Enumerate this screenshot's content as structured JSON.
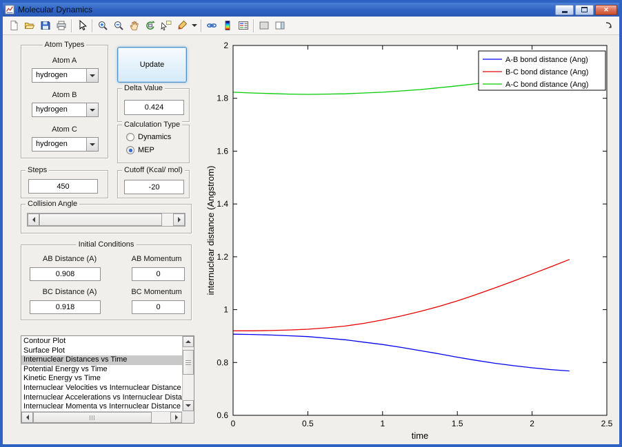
{
  "window": {
    "title": "Molecular Dynamics"
  },
  "toolbar": {
    "icons": [
      "new-figure",
      "open-file",
      "save-figure",
      "print-figure",
      "edit-plot",
      "zoom-in",
      "zoom-out",
      "pan",
      "rotate-3d",
      "data-cursor",
      "brush-data",
      "link-plot",
      "insert-colorbar",
      "insert-legend",
      "hide-plot-tools",
      "show-plot-tools",
      "dock-figure"
    ]
  },
  "panel": {
    "atom_types": {
      "title": "Atom Types",
      "selects": [
        {
          "label": "Atom A",
          "value": "hydrogen"
        },
        {
          "label": "Atom B",
          "value": "hydrogen"
        },
        {
          "label": "Atom C",
          "value": "hydrogen"
        }
      ]
    },
    "update_button_label": "Update",
    "delta": {
      "title": "Delta Value",
      "value": "0.424"
    },
    "calculation_type": {
      "title": "Calculation Type",
      "options": [
        {
          "label": "Dynamics",
          "selected": false
        },
        {
          "label": "MEP",
          "selected": true
        }
      ]
    },
    "steps": {
      "title": "Steps",
      "value": "450"
    },
    "cutoff": {
      "title": "Cutoff (Kcal/ mol)",
      "value": "-20"
    },
    "collision_angle": {
      "title": "Collision Angle"
    },
    "initial_conditions": {
      "title": "Initial Conditions",
      "fields": [
        {
          "label": "AB Distance (A)",
          "value": "0.908"
        },
        {
          "label": "AB Momentum",
          "value": "0"
        },
        {
          "label": "BC Distance (A)",
          "value": "0.918"
        },
        {
          "label": "BC Momentum",
          "value": "0"
        }
      ]
    },
    "plot_list": {
      "selected_index": 2,
      "items": [
        "Contour Plot",
        "Surface Plot",
        "Internuclear Distances vs Time",
        "Potential Energy vs Time",
        "Kinetic Energy vs Time",
        "Internuclear Velocities vs Internuclear Distance",
        "Internuclear Accelerations vs Internuclear Dista",
        "Internuclear Momenta vs Internuclear Distance"
      ]
    }
  },
  "chart_data": {
    "type": "line",
    "title": "",
    "xlabel": "time",
    "ylabel": "internuclear distance (Angstrom)",
    "xlim": [
      0,
      2.5
    ],
    "ylim": [
      0.6,
      2
    ],
    "xticks": [
      0,
      0.5,
      1,
      1.5,
      2,
      2.5
    ],
    "yticks": [
      0.6,
      0.8,
      1,
      1.2,
      1.4,
      1.6,
      1.8,
      2
    ],
    "grid": false,
    "legend_position": "top-right",
    "axis_color": "#000000",
    "x": [
      0,
      0.125,
      0.25,
      0.375,
      0.5,
      0.625,
      0.75,
      0.875,
      1,
      1.125,
      1.25,
      1.375,
      1.5,
      1.625,
      1.75,
      1.875,
      2,
      2.125,
      2.25
    ],
    "series": [
      {
        "name": "A-B bond distance (Ang)",
        "color": "#0000ee",
        "y": [
          0.907,
          0.906,
          0.904,
          0.901,
          0.898,
          0.892,
          0.886,
          0.877,
          0.868,
          0.857,
          0.845,
          0.833,
          0.82,
          0.808,
          0.797,
          0.788,
          0.78,
          0.773,
          0.768
        ]
      },
      {
        "name": "B-C bond distance (Ang)",
        "color": "#e80000",
        "y": [
          0.92,
          0.92,
          0.921,
          0.923,
          0.926,
          0.931,
          0.938,
          0.948,
          0.961,
          0.976,
          0.993,
          1.012,
          1.033,
          1.057,
          1.082,
          1.108,
          1.135,
          1.162,
          1.19
        ]
      },
      {
        "name": "A-C bond distance (Ang)",
        "color": "#00cc00",
        "y": [
          1.823,
          1.82,
          1.818,
          1.816,
          1.815,
          1.816,
          1.817,
          1.82,
          1.823,
          1.828,
          1.833,
          1.84,
          1.847,
          1.855,
          1.864,
          1.873,
          1.882,
          1.891,
          1.9
        ]
      }
    ]
  }
}
